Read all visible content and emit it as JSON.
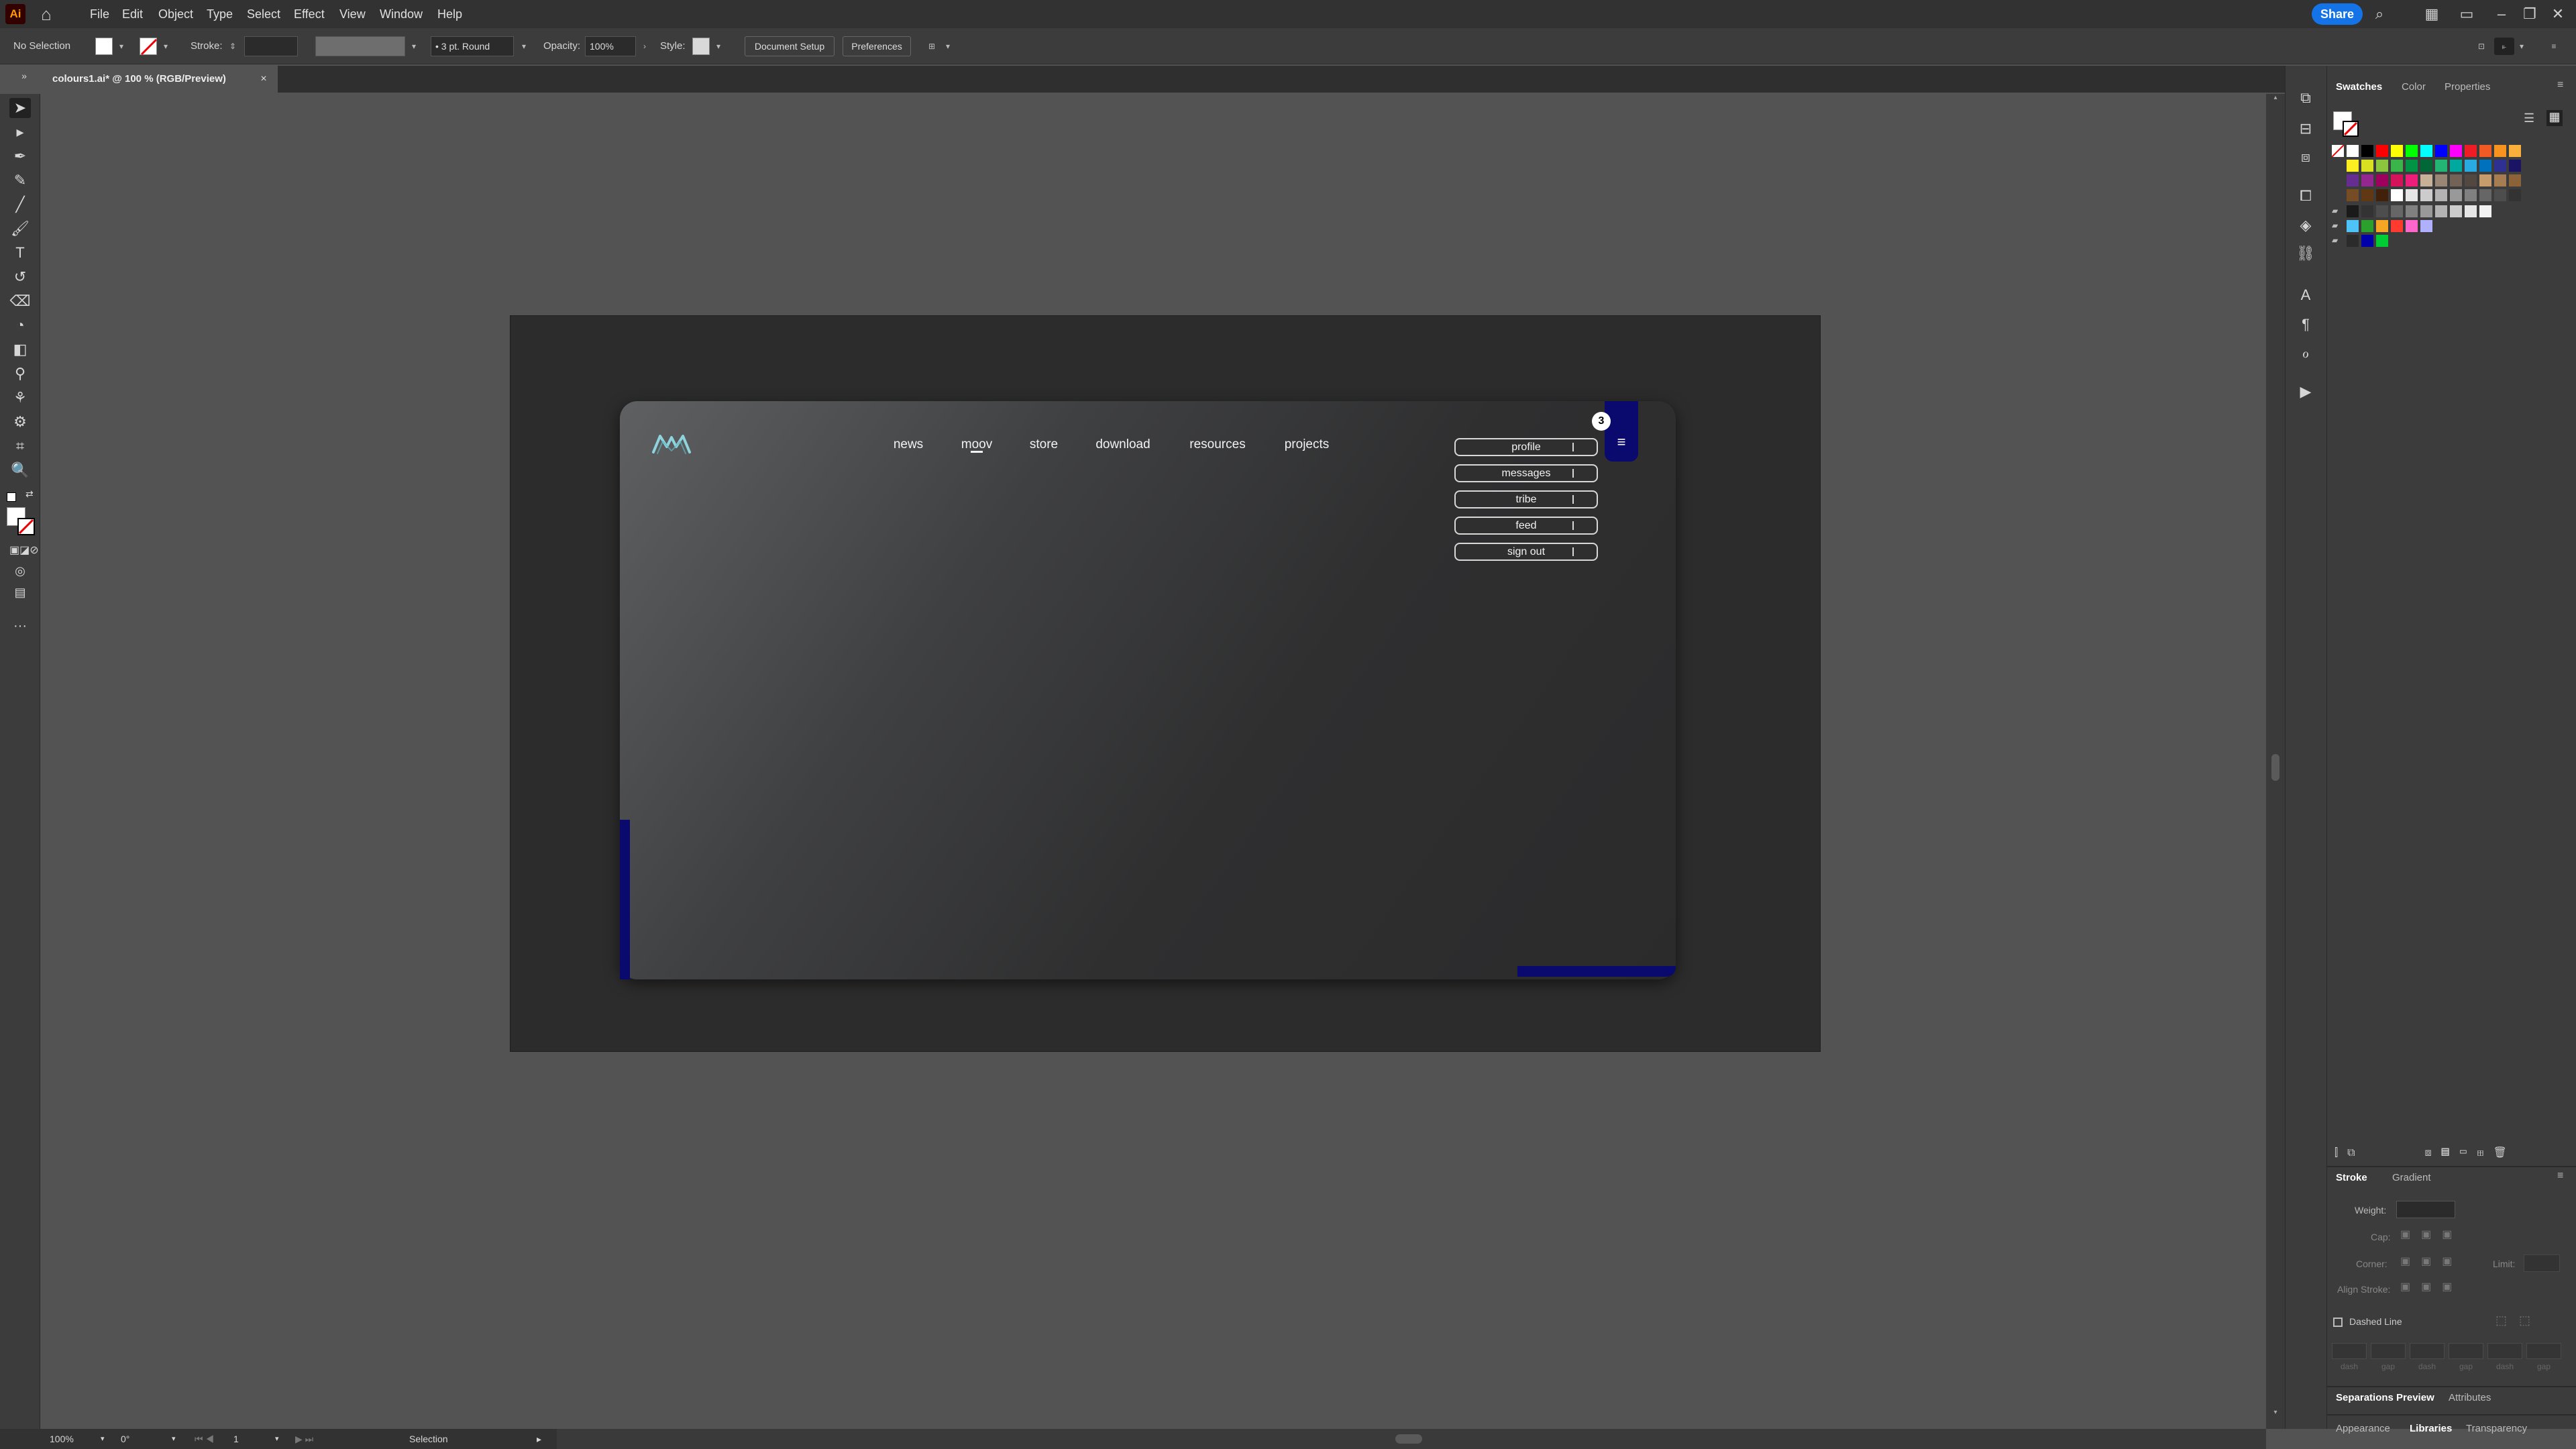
{
  "menubar": {
    "app_icon": "Ai",
    "items": [
      "File",
      "Edit",
      "Object",
      "Type",
      "Select",
      "Effect",
      "View",
      "Window",
      "Help"
    ],
    "share": "Share"
  },
  "control": {
    "selection": "No Selection",
    "stroke_label": "Stroke:",
    "brush": "3 pt. Round",
    "opacity_label": "Opacity:",
    "opacity_value": "100%",
    "style_label": "Style:",
    "document_setup": "Document Setup",
    "preferences": "Preferences"
  },
  "document": {
    "tab_title": "colours1.ai* @ 100 % (RGB/Preview)",
    "close": "×"
  },
  "design": {
    "nav": [
      "news",
      "moov",
      "store",
      "download",
      "resources",
      "projects"
    ],
    "menu": [
      "profile",
      "messages",
      "tribe",
      "feed",
      "sign out"
    ],
    "badge": "3",
    "hamburger": "≡",
    "accent_color": "#0a0a6e",
    "logo_color": "#8fd3dc"
  },
  "panel": {
    "tabs": [
      "Swatches",
      "Color",
      "Properties"
    ],
    "stroke_tabs": [
      "Stroke",
      "Gradient"
    ],
    "stroke": {
      "weight": "Weight:",
      "cap": "Cap:",
      "corner": "Corner:",
      "limit": "Limit:",
      "align": "Align Stroke:",
      "dashed": "Dashed Line",
      "dash_labels": [
        "dash",
        "gap",
        "dash",
        "gap",
        "dash",
        "gap"
      ]
    },
    "bottom_tabs1": [
      "Separations Preview",
      "Attributes"
    ],
    "bottom_tabs2": [
      "Appearance",
      "Libraries",
      "Transparency"
    ],
    "swatch_colors": [
      [
        "#ffffff",
        "#000000",
        "#ff0000",
        "#ffff00",
        "#00ff00",
        "#00ffff",
        "#0000ff",
        "#ff00ff",
        "#ee1c25",
        "#f15a24",
        "#f7931e",
        "#fbb03b"
      ],
      [
        "#fcee21",
        "#d9e021",
        "#8cc63f",
        "#39b54a",
        "#009245",
        "#006837",
        "#22b573",
        "#00a99d",
        "#29abe2",
        "#0071bc",
        "#2e3192",
        "#1b1464"
      ],
      [
        "#662d91",
        "#93278f",
        "#9e005d",
        "#d4145a",
        "#ed1e79",
        "#c7b299",
        "#998675",
        "#736357",
        "#534741",
        "#c69c6d",
        "#a67c52",
        "#8c6239"
      ],
      [
        "#754c24",
        "#603813",
        "#42210b",
        "#ffffff",
        "#e6e6e6",
        "#cccccc",
        "#b3b3b3",
        "#999999",
        "#808080",
        "#666666",
        "#4d4d4d",
        "#333333"
      ]
    ],
    "group_row1": [
      "#1a1a1a",
      "#333333",
      "#4d4d4d",
      "#666666",
      "#808080",
      "#999999",
      "#b3b3b3",
      "#cccccc",
      "#e6e6e6",
      "#f2f2f2"
    ],
    "group_row2": [
      "#4ec3f7",
      "#2ca02c",
      "#f5a623",
      "#ff3b30",
      "#ff66cc",
      "#b0b0ff"
    ],
    "group_row3": [
      "#2b2b2b",
      "#0000aa",
      "#00cc33"
    ]
  },
  "status": {
    "zoom": "100%",
    "rotate": "0°",
    "artboard": "1",
    "tool": "Selection"
  }
}
